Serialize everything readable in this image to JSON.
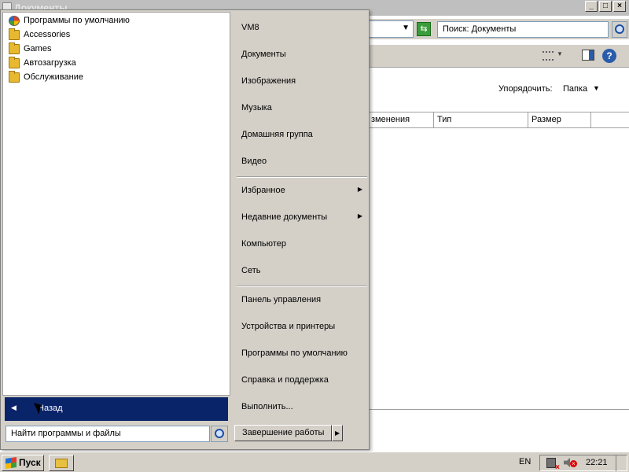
{
  "window": {
    "title": "Документы",
    "minimize": "_",
    "maximize": "□",
    "close": "×"
  },
  "address_bar": {
    "dropdown_glyph": "▼",
    "go_glyph": "⇆",
    "search_value": "Поиск: Документы"
  },
  "toolbar": {
    "views_arrow": "▼",
    "help_glyph": "?"
  },
  "content": {
    "arrange_label": "Упорядочить:",
    "arrange_value": "Папка",
    "arrange_arrow": "▼",
    "columns": [
      "зменения",
      "Тип",
      "Размер"
    ]
  },
  "start_menu": {
    "programs": [
      {
        "label": "Программы по умолчанию",
        "icon": "default-programs-icon"
      },
      {
        "label": "Accessories",
        "icon": "folder-icon"
      },
      {
        "label": "Games",
        "icon": "folder-icon"
      },
      {
        "label": "Автозагрузка",
        "icon": "folder-icon"
      },
      {
        "label": "Обслуживание",
        "icon": "folder-icon"
      }
    ],
    "back_arrow": "◀",
    "back_label": "Назад",
    "search_placeholder": "Найти программы и файлы",
    "places_group1": [
      "VM8",
      "Документы",
      "Изображения",
      "Музыка",
      "Домашняя группа",
      "Видео"
    ],
    "places_group2": [
      {
        "label": "Избранное",
        "arrow": "▶"
      },
      {
        "label": "Недавние документы",
        "arrow": "▶"
      },
      {
        "label": "Компьютер",
        "arrow": ""
      },
      {
        "label": "Сеть",
        "arrow": ""
      }
    ],
    "places_group3": [
      "Панель управления",
      "Устройства и принтеры",
      "Программы по умолчанию",
      "Справка и поддержка",
      "Выполнить..."
    ],
    "shutdown_label": "Завершение работы",
    "shutdown_arrow": "▶"
  },
  "taskbar": {
    "start_label": "Пуск",
    "language": "EN",
    "clock": "22:21"
  },
  "colors": {
    "selection": "#0a246a",
    "face": "#d4d0c8"
  }
}
